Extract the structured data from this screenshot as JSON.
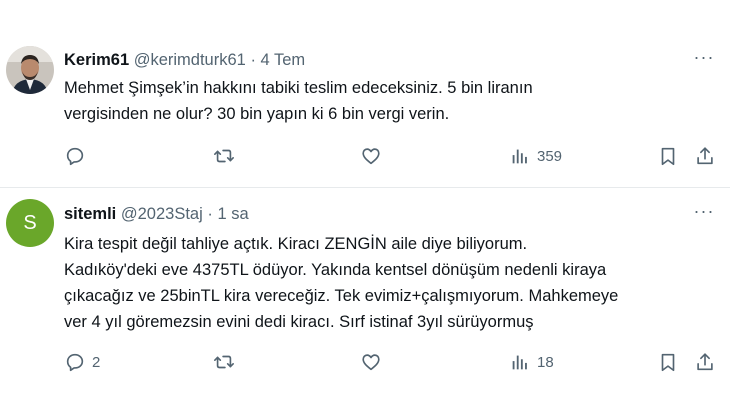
{
  "tweets": [
    {
      "name": "Kerim61",
      "handle": "@kerimdturk61",
      "separator": "·",
      "time": "4 Tem",
      "more": "···",
      "lines": [
        "Mehmet Şimşek’in hakkını tabiki teslim edeceksiniz. 5 bin liranın",
        "vergisinden ne olur? 30 bin yapın ki 6 bin vergi verin."
      ],
      "replies": "",
      "views": "359"
    },
    {
      "name": "sitemli",
      "handle": "@2023Staj",
      "separator": "·",
      "time": "1 sa",
      "more": "···",
      "avatar_letter": "S",
      "lines": [
        "Kira tespit değil tahliye açtık. Kiracı ZENGİN aile diye biliyorum.",
        "Kadıköy'deki eve 4375TL ödüyor. Yakında kentsel dönüşüm nedenli kiraya",
        "çıkacağız ve 25binTL kira vereceğiz. Tek evimiz+çalışmıyorum. Mahkemeye",
        "ver 4 yıl göremezsin evini dedi kiracı. Sırf istinaf 3yıl sürüyormuş"
      ],
      "replies": "2",
      "views": "18"
    }
  ],
  "colors": {
    "text": "#0f1419",
    "secondary": "#536471",
    "divider": "#e7eaec",
    "avatar_green": "#6aa72a"
  },
  "icons": [
    "reply-icon",
    "retweet-icon",
    "like-icon",
    "views-icon",
    "bookmark-icon",
    "share-icon",
    "more-icon"
  ]
}
